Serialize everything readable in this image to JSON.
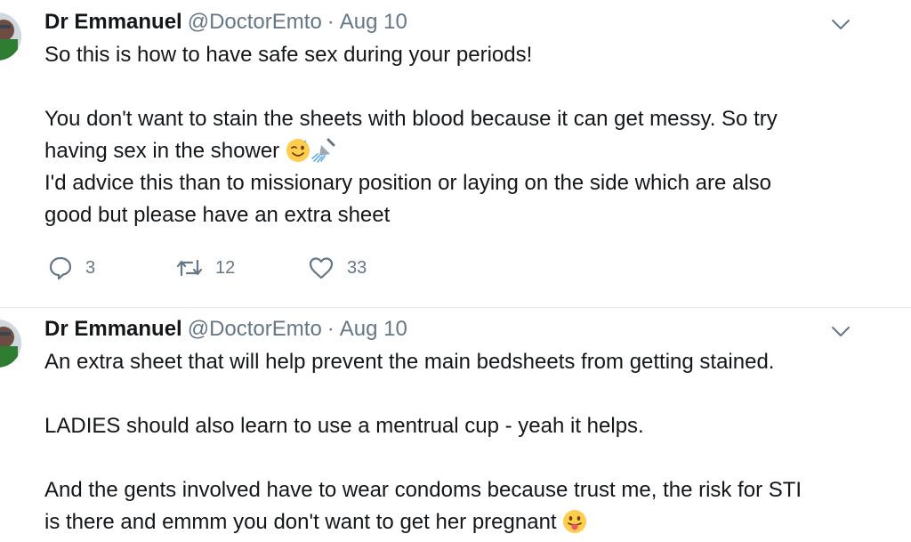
{
  "tweets": [
    {
      "display_name": "Dr Emmanuel",
      "handle": "@DoctorEmto",
      "separator": "·",
      "date": "Aug 10",
      "lines": [
        "So this is how to have safe sex during your periods!",
        "",
        "You don't want to stain the sheets with blood because it can get messy. So try",
        "having sex in the shower",
        "I'd advice  this than to missionary position or laying on the side which are also",
        "good but please have an extra sheet"
      ],
      "emojis": [
        "winking-face",
        "shower"
      ],
      "actions": {
        "replies": "3",
        "retweets": "12",
        "likes": "33"
      }
    },
    {
      "display_name": "Dr Emmanuel",
      "handle": "@DoctorEmto",
      "separator": "·",
      "date": "Aug 10",
      "lines": [
        "An extra sheet that will help prevent the main bedsheets from getting stained.",
        "",
        "LADIES should also learn to use a mentrual cup - yeah it helps.",
        "",
        "And the gents involved have to wear condoms because trust me, the risk for STI",
        "is there and emmm you don't want to get her pregnant"
      ],
      "emojis": [
        "face-with-tongue"
      ]
    }
  ],
  "colors": {
    "text": "#14171a",
    "secondary": "#657786",
    "divider": "#e6ecf0"
  }
}
